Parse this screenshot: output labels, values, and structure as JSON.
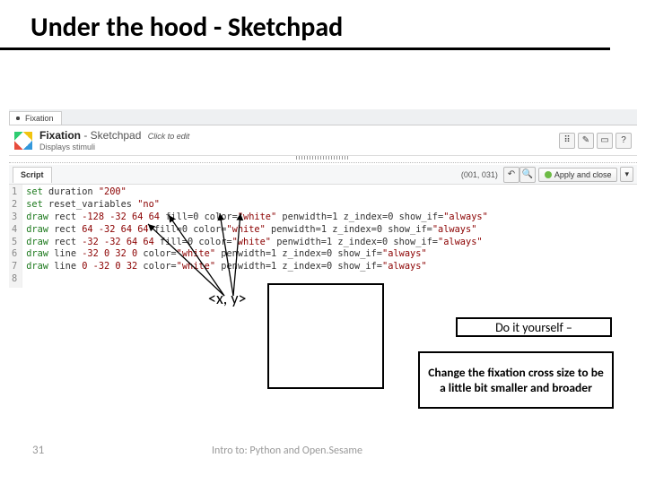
{
  "slide": {
    "title": "Under the hood - Sketchpad",
    "footer_num": "31",
    "footer_text": "Intro to: Python and Open.Sesame"
  },
  "app": {
    "tab": {
      "icon": "+",
      "label": "Fixation"
    },
    "header": {
      "title_bold": "Fixation",
      "title_rest": " - Sketchpad",
      "click_to_edit": "Click to edit",
      "subtitle": "Displays stimuli",
      "btns": [
        "pick-icon",
        "rename-icon",
        "minimize-icon",
        "help-icon"
      ]
    },
    "toolbar": {
      "script_tab": "Script",
      "coords": "(001, 031)",
      "search": "search-icon",
      "apply": "Apply and close",
      "dropdown": "▾"
    },
    "code": {
      "lines": [
        "set duration \"200\"",
        "set reset_variables \"no\"",
        "draw rect -128 -32 64 64 fill=0 color=\"white\" penwidth=1 z_index=0 show_if=\"always\"",
        "draw rect 64 -32 64 64 fill=0 color=\"white\" penwidth=1 z_index=0 show_if=\"always\"",
        "draw rect -32 -32 64 64 fill=0 color=\"white\" penwidth=1 z_index=0 show_if=\"always\"",
        "draw line -32 0 32 0 color=\"white\" penwidth=1 z_index=0 show_if=\"always\"",
        "draw line 0 -32 0 32 color=\"white\" penwidth=1 z_index=0 show_if=\"always\"",
        ""
      ]
    }
  },
  "annotation": {
    "xy_label": "<x, y>",
    "diy": "Do it yourself –",
    "task": "Change the fixation cross size to be a little bit smaller and broader"
  }
}
